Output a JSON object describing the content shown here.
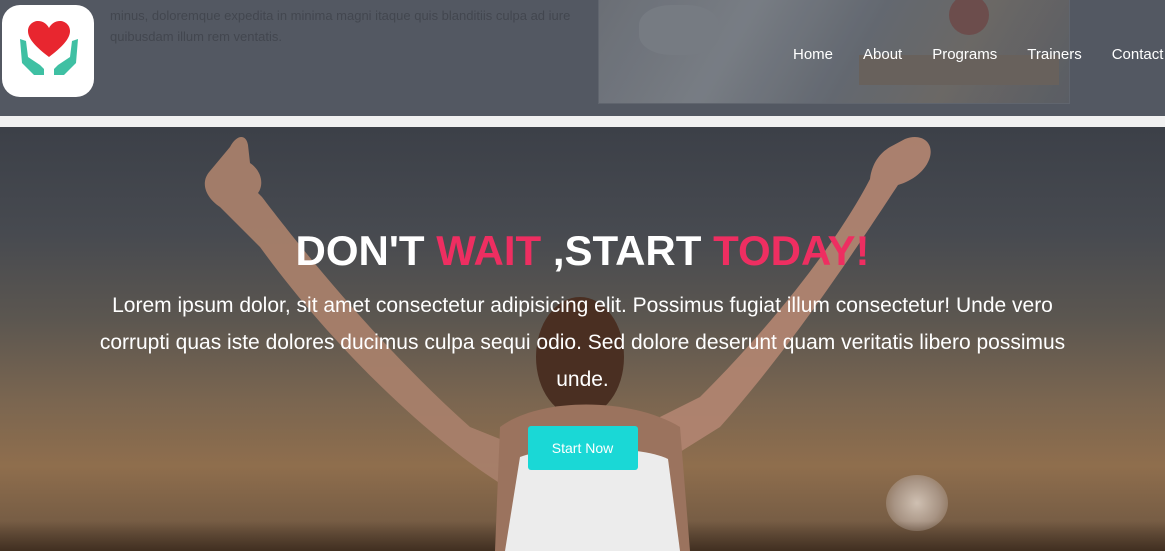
{
  "header": {
    "background_text": "minus, doloremque expedita in minima magni itaque quis blanditiis culpa ad iure quibusdam illum rem ventatis.",
    "logo_icon": "heart-hands-icon",
    "nav": [
      {
        "label": "Home"
      },
      {
        "label": "About"
      },
      {
        "label": "Programs"
      },
      {
        "label": "Trainers"
      },
      {
        "label": "Contact"
      }
    ]
  },
  "hero": {
    "headline": {
      "part1": "DON'T ",
      "part2": "WAIT",
      "part3": " ,START ",
      "part4": "TODAY!"
    },
    "description": "Lorem ipsum dolor, sit amet consectetur adipisicing elit. Possimus fugiat illum consectetur! Unde vero corrupti quas iste dolores ducimus culpa sequi odio. Sed dolore deserunt quam veritatis libero possimus unde.",
    "cta_label": "Start Now"
  },
  "colors": {
    "accent_pink": "#ee2e61",
    "accent_teal": "#1ad8d6",
    "logo_heart": "#e8262f",
    "logo_hands": "#3fc0a3"
  }
}
